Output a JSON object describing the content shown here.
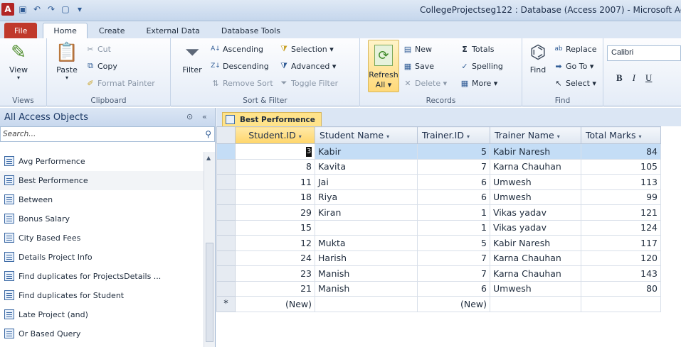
{
  "window": {
    "title": "CollegeProjectseg122 : Database (Access 2007) - Microsoft Ac",
    "app_icon": "A"
  },
  "ribbon_tabs": [
    "File",
    "Home",
    "Create",
    "External Data",
    "Database Tools"
  ],
  "ribbon": {
    "views": {
      "view_label": "View",
      "group_label": "Views"
    },
    "clipboard": {
      "paste": "Paste",
      "cut": "Cut",
      "copy": "Copy",
      "format_painter": "Format Painter",
      "group_label": "Clipboard"
    },
    "sort_filter": {
      "filter": "Filter",
      "ascending": "Ascending",
      "descending": "Descending",
      "remove_sort": "Remove Sort",
      "selection": "Selection ▾",
      "advanced": "Advanced ▾",
      "toggle_filter": "Toggle Filter",
      "group_label": "Sort & Filter"
    },
    "records": {
      "refresh": "Refresh",
      "refresh_all": "All ▾",
      "new": "New",
      "save": "Save",
      "delete": "Delete ▾",
      "totals": "Totals",
      "spelling": "Spelling",
      "more": "More ▾",
      "group_label": "Records"
    },
    "find": {
      "find": "Find",
      "replace": "Replace",
      "goto": "Go To ▾",
      "select": "Select ▾",
      "group_label": "Find"
    },
    "font": {
      "font_name": "Calibri",
      "bold": "B",
      "italic": "I",
      "underline": "U"
    }
  },
  "nav_pane": {
    "header": "All Access Objects",
    "search_placeholder": "Search...",
    "items": [
      "Avg Performence",
      "Best Performence",
      "Between",
      "Bonus Salary",
      "City Based Fees",
      "Details Project Info",
      "Find duplicates for ProjectsDetails ...",
      "Find duplicates for Student",
      "Late Project (and)",
      "Or Based Query"
    ]
  },
  "document": {
    "tab_label": "Best Performence",
    "columns": [
      "Student.ID",
      "Student Name",
      "Trainer.ID",
      "Trainer Name",
      "Total Marks"
    ],
    "rows": [
      [
        "3",
        "Kabir",
        "5",
        "Kabir Naresh",
        "84"
      ],
      [
        "8",
        "Kavita",
        "7",
        "Karna Chauhan",
        "105"
      ],
      [
        "11",
        "Jai",
        "6",
        "Umwesh",
        "113"
      ],
      [
        "18",
        "Riya",
        "6",
        "Umwesh",
        "99"
      ],
      [
        "29",
        "Kiran",
        "1",
        "Vikas yadav",
        "121"
      ],
      [
        "15",
        "",
        "1",
        "Vikas yadav",
        "124"
      ],
      [
        "12",
        "Mukta",
        "5",
        "Kabir Naresh",
        "117"
      ],
      [
        "24",
        "Harish",
        "7",
        "Karna Chauhan",
        "120"
      ],
      [
        "23",
        "Manish",
        "7",
        "Karna Chauhan",
        "143"
      ],
      [
        "21",
        "Manish",
        "6",
        "Umwesh",
        "80"
      ]
    ],
    "new_row": {
      "marker": "*",
      "student_id": "(New)",
      "trainer_id": "(New)"
    }
  }
}
